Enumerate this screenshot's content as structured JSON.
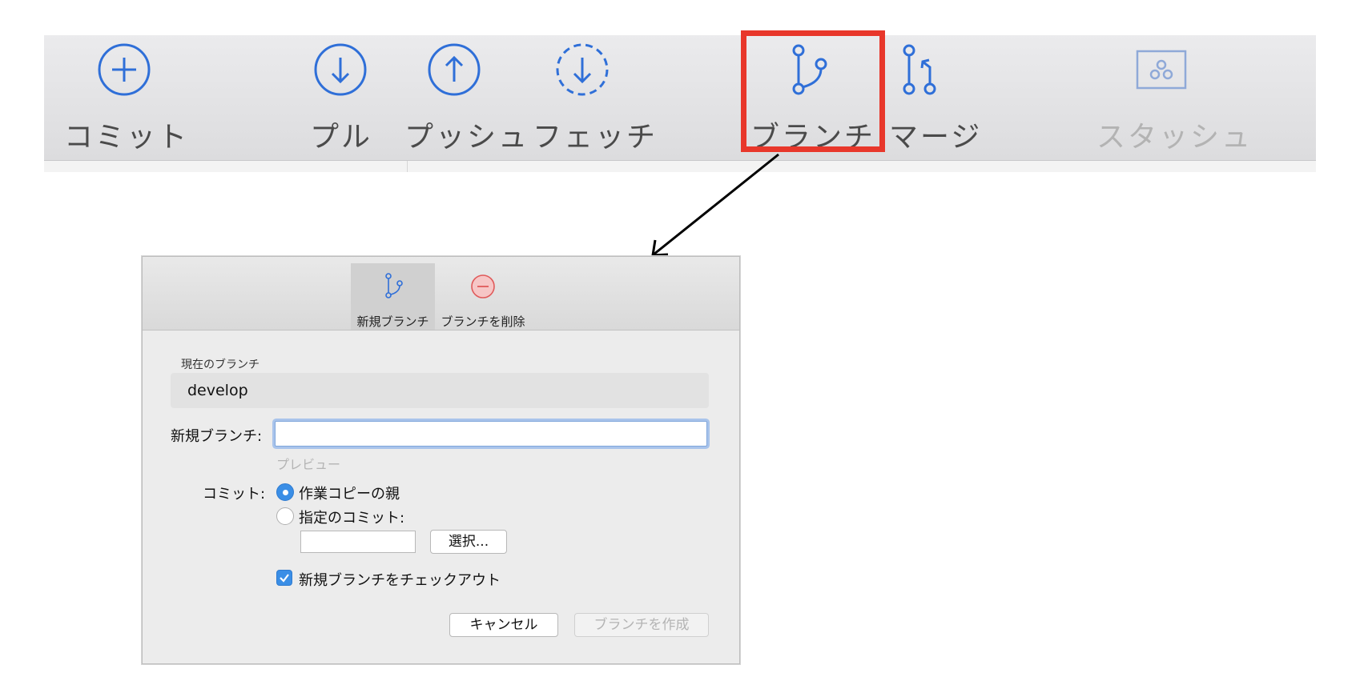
{
  "toolbar": {
    "commit_label": "コミット",
    "pull_label": "プル",
    "push_label": "プッシュ",
    "fetch_label": "フェッチ",
    "branch_label": "ブランチ",
    "merge_label": "マージ",
    "stash_label": "スタッシュ"
  },
  "dialog": {
    "tabs": {
      "new_branch": "新規ブランチ",
      "delete_branch": "ブランチを削除"
    },
    "current_branch_caption": "現在のブランチ",
    "current_branch_value": "develop",
    "new_branch_label": "新規ブランチ:",
    "new_branch_value": "",
    "preview_text": "プレビュー",
    "commit_label": "コミット:",
    "radio_working_copy_parent": "作業コピーの親",
    "radio_specified_commit": "指定のコミット:",
    "specified_commit_value": "",
    "select_button": "選択...",
    "checkout_checkbox": "新規ブランチをチェックアウト",
    "cancel_button": "キャンセル",
    "create_button": "ブランチを作成"
  },
  "colors": {
    "accent": "#3a8ee6",
    "icon_blue": "#2f6fd8",
    "highlight_red": "#e8372b",
    "delete_red": "#e05a5a"
  },
  "icons": {
    "commit": "plus-circle-icon",
    "pull": "arrow-down-circle-icon",
    "push": "arrow-up-circle-icon",
    "fetch": "arrow-down-dashed-circle-icon",
    "branch": "branch-icon",
    "merge": "merge-icon",
    "stash": "stash-icon",
    "delete": "minus-circle-icon"
  }
}
